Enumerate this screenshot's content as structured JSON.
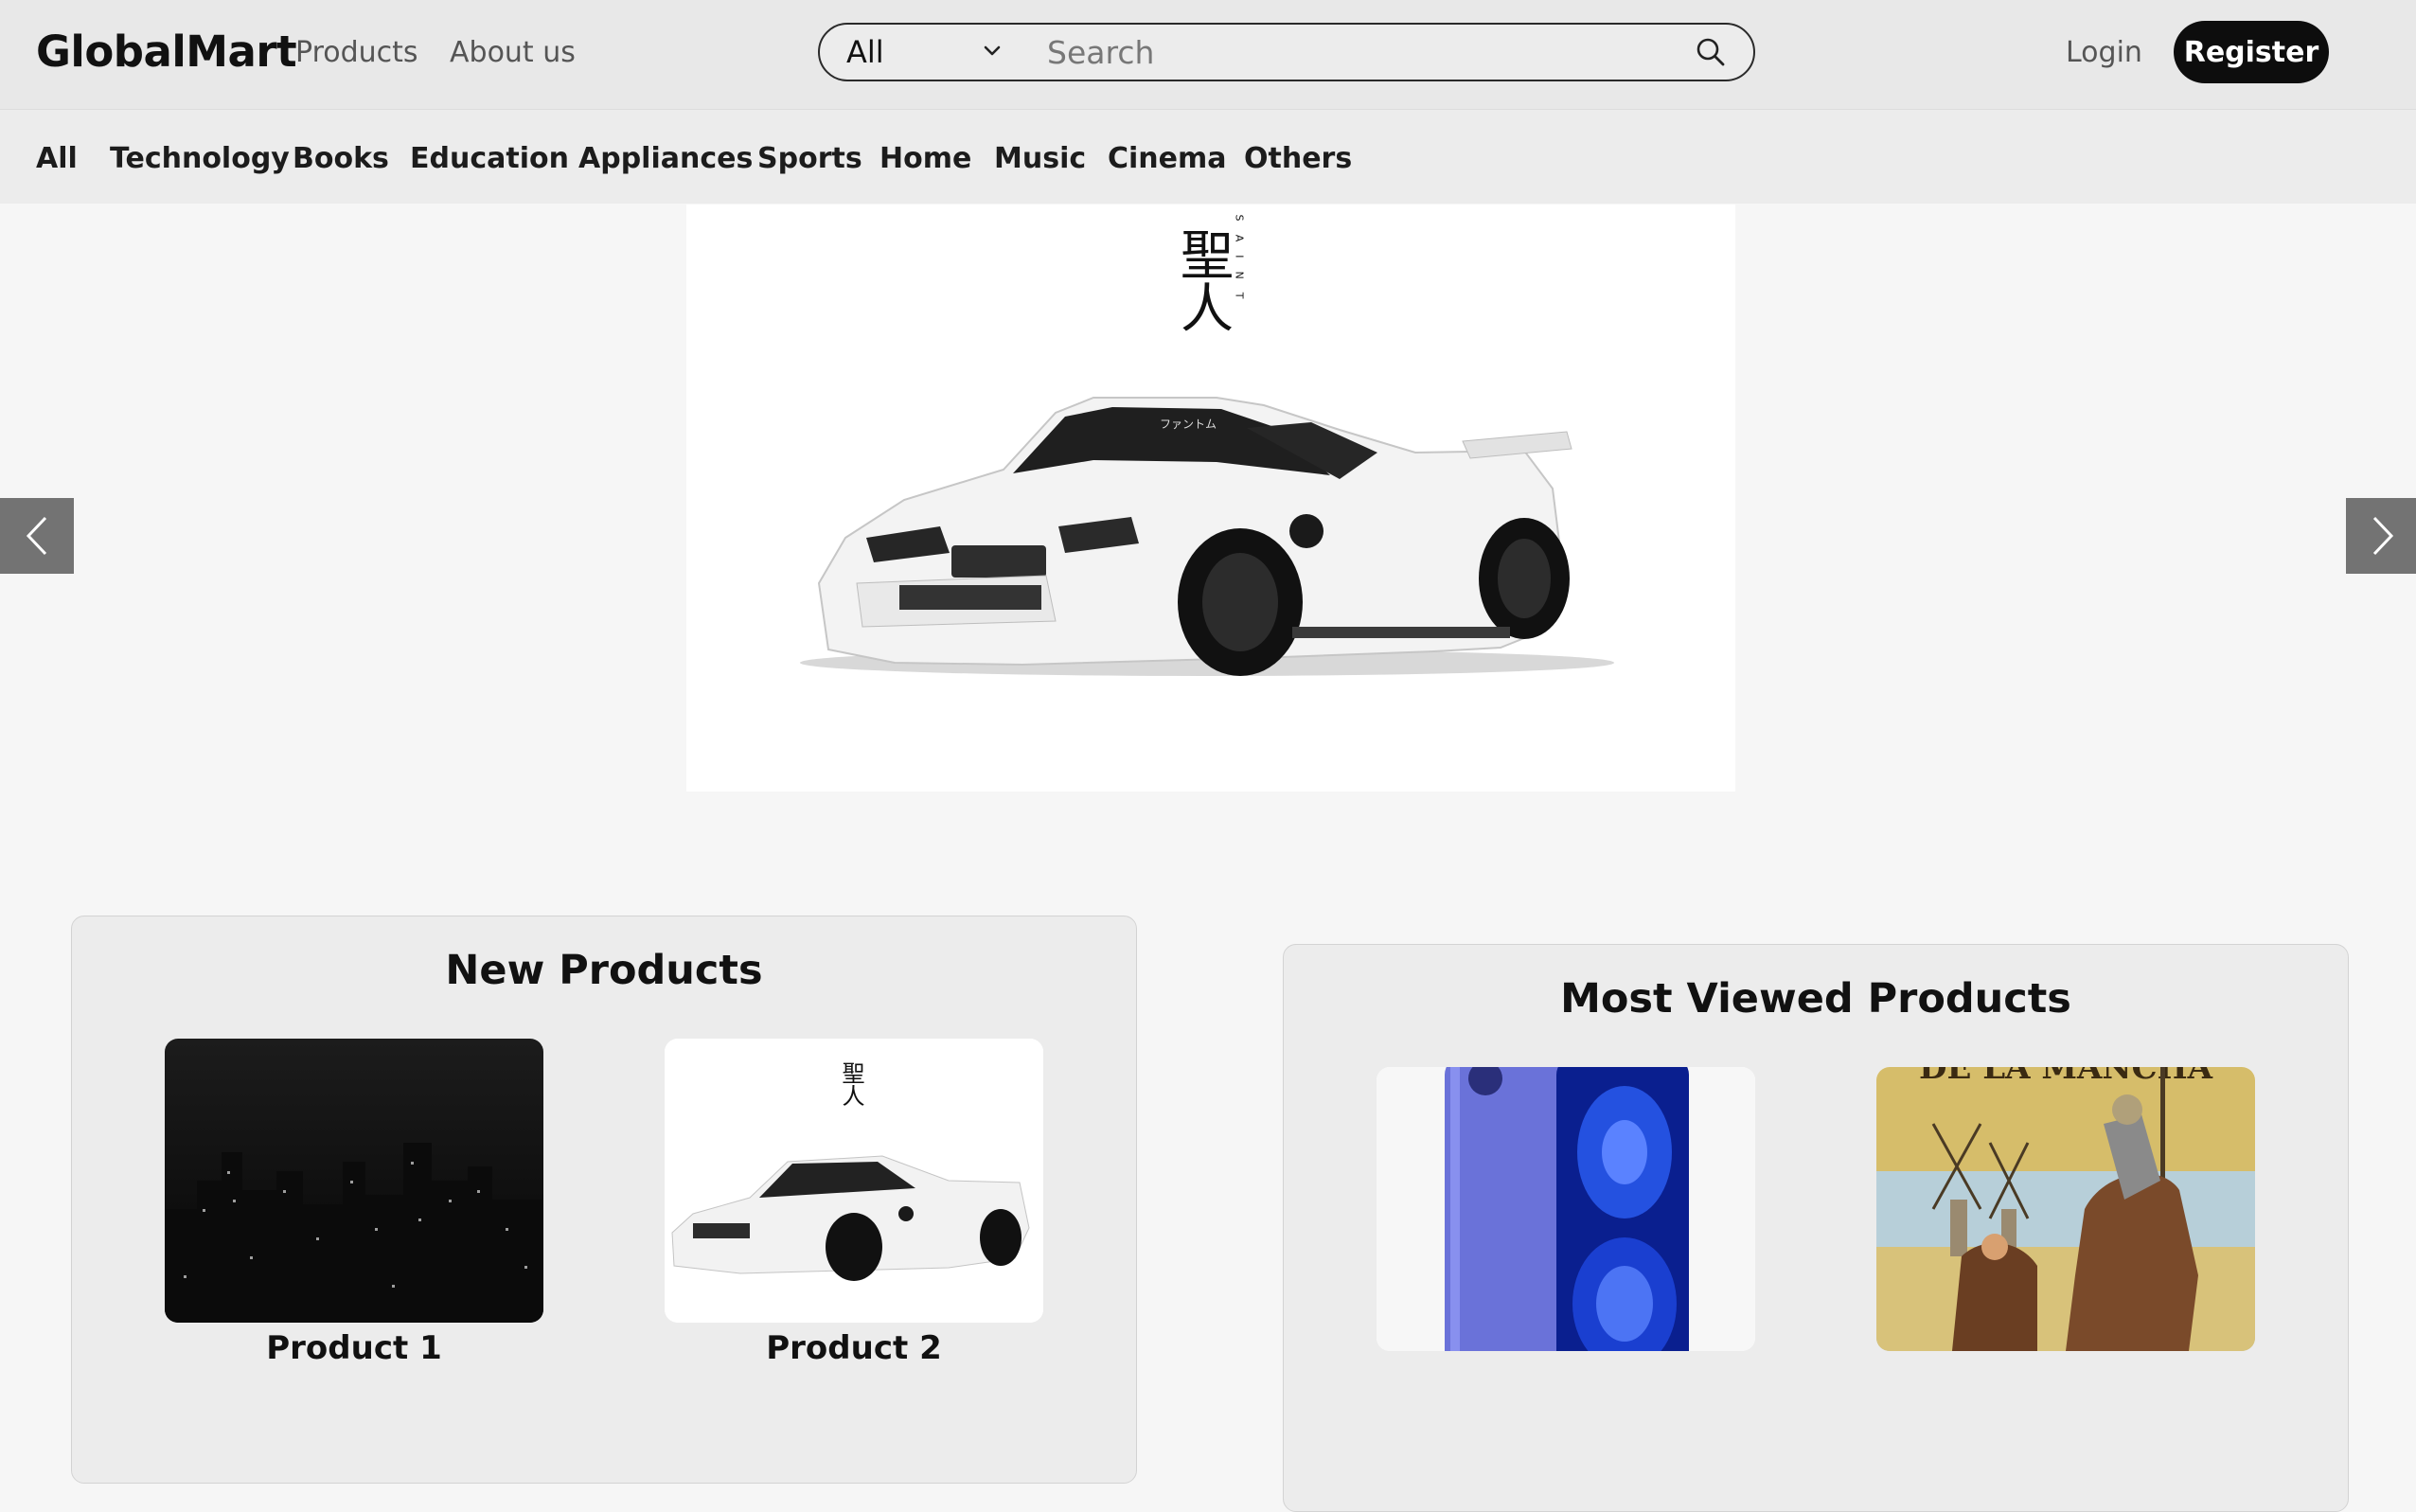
{
  "header": {
    "brand": "GlobalMart",
    "nav": [
      "Products",
      "About us"
    ],
    "search": {
      "category": "All",
      "placeholder": "Search"
    },
    "login": "Login",
    "register": "Register"
  },
  "categories": [
    "All",
    "Technology",
    "Books",
    "Education",
    "Appliances",
    "Sports",
    "Home",
    "Music",
    "Cinema",
    "Others"
  ],
  "carousel": {
    "prev_icon": "chevron-left-icon",
    "next_icon": "chevron-right-icon",
    "slide_text": {
      "kanji": "聖人",
      "vertical": "SAINT",
      "windshield": "ファントム"
    }
  },
  "sections": {
    "new_products": {
      "title": "New Products",
      "items": [
        {
          "label": "Product 1",
          "image": "city-at-night"
        },
        {
          "label": "Product 2",
          "image": "white-sports-car"
        }
      ]
    },
    "most_viewed": {
      "title": "Most Viewed Products",
      "items": [
        {
          "image": "blue-smartphone"
        },
        {
          "image": "don-quixote-book-cover",
          "cover_text": "DE LA MANCHA"
        }
      ]
    }
  },
  "colors": {
    "header_bg": "#e8e8e8",
    "register_bg": "#0d0d0d",
    "arrow_bg": "#737373"
  }
}
